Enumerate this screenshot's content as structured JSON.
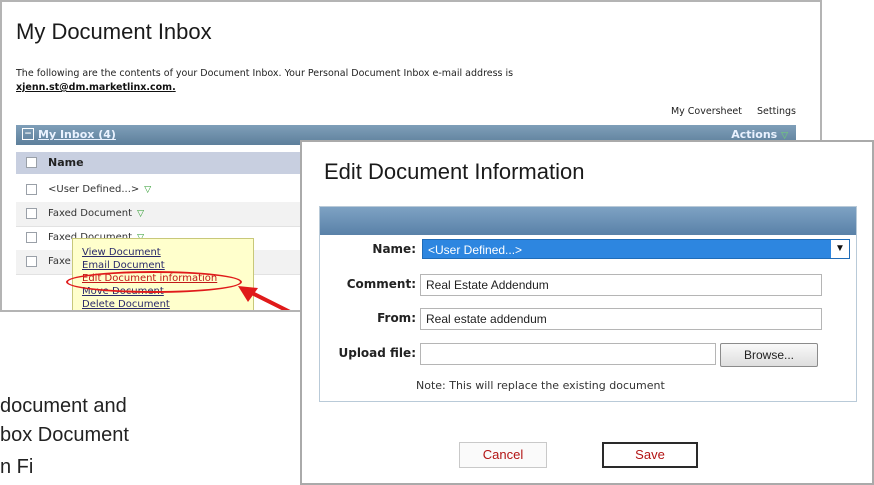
{
  "inbox": {
    "title": "My Document Inbox",
    "description": "The following are the contents of your Document Inbox. Your Personal Document Inbox e-mail address is",
    "email": "xjenn.st@dm.marketlinx.com",
    "email_suffix": ".",
    "links": [
      "My Coversheet",
      "Settings"
    ],
    "bar_title": "My Inbox (4)",
    "actions_label": "Actions",
    "column_name": "Name",
    "rows": [
      "<User Defined...>",
      "Faxed Document",
      "Faxed Document",
      "Faxe"
    ]
  },
  "context_menu": {
    "items": [
      "View Document",
      "Email Document",
      "Edit Document information",
      "Move Document",
      "Delete Document"
    ]
  },
  "dialog": {
    "title": "Edit Document Information",
    "name_label": "Name:",
    "name_value": "<User Defined...>",
    "comment_label": "Comment:",
    "comment_value": "Real Estate Addendum",
    "from_label": "From:",
    "from_value": "Real estate addendum",
    "upload_label": "Upload file:",
    "upload_value": "",
    "browse_label": "Browse...",
    "note": "Note: This will replace the existing document",
    "cancel_label": "Cancel",
    "save_label": "Save"
  },
  "side_text": {
    "line1": "document and",
    "line2": "box Document",
    "line3": "n  Fi"
  },
  "colors": {
    "highlight": "#e01a1a",
    "bar": "#5d7f9b",
    "selected": "#2d86e0"
  }
}
